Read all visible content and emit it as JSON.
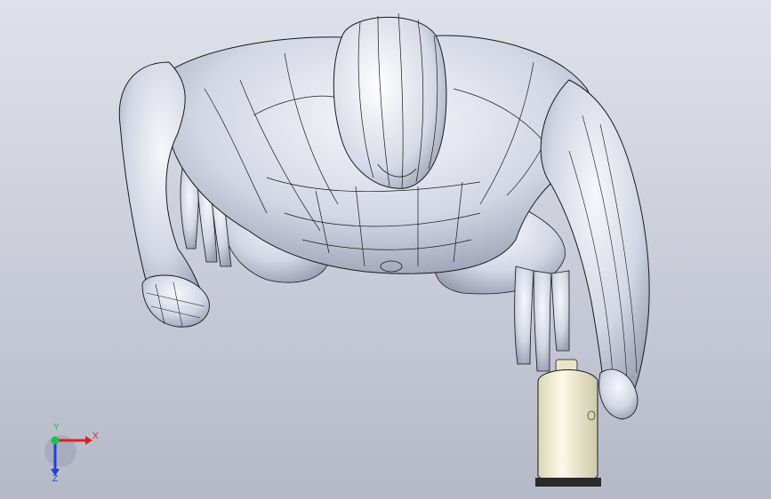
{
  "viewport": {
    "background_top": "#dfe1ea",
    "background_bottom": "#b5b9c7"
  },
  "model": {
    "figure_shade": "#cfd2e0",
    "figure_highlight": "#f4f5fb",
    "edge_color": "#1a1a1a",
    "bottle_color": "#f3f1da"
  },
  "triad": {
    "x_label": "X",
    "y_label": "Y",
    "z_label": "Z",
    "x_color": "#e02020",
    "y_color": "#20c040",
    "z_color": "#2040e0"
  }
}
